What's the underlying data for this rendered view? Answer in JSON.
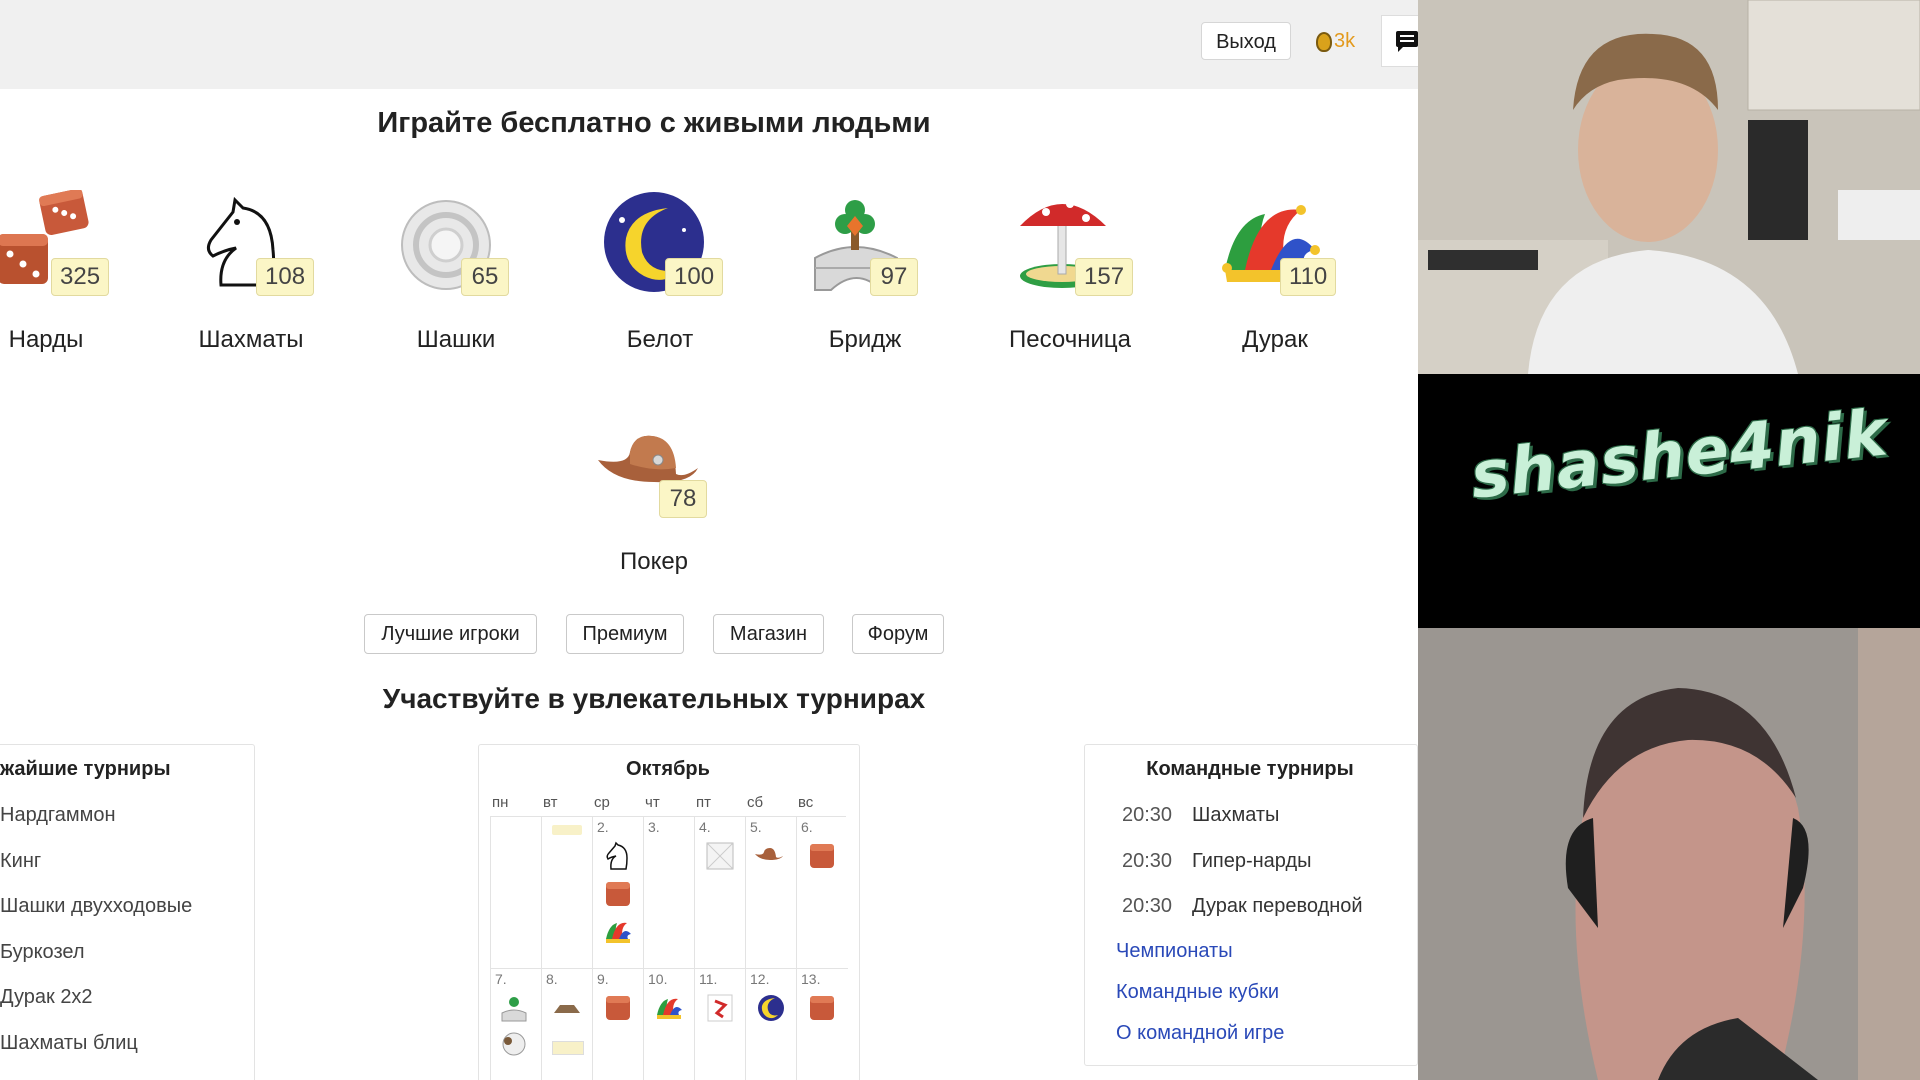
{
  "topbar": {
    "exit_label": "Выход",
    "coins": "3k"
  },
  "heading_play": "Играйте бесплатно с живыми людьми",
  "games": [
    {
      "name": "Нарды",
      "count": "325",
      "icon": "dice-icon"
    },
    {
      "name": "Шахматы",
      "count": "108",
      "icon": "chess-knight-icon"
    },
    {
      "name": "Шашки",
      "count": "65",
      "icon": "checker-piece-icon"
    },
    {
      "name": "Белот",
      "count": "100",
      "icon": "moon-icon"
    },
    {
      "name": "Бридж",
      "count": "97",
      "icon": "bridge-icon"
    },
    {
      "name": "Песочница",
      "count": "157",
      "icon": "mushroom-sandbox-icon"
    },
    {
      "name": "Дурак",
      "count": "110",
      "icon": "jester-hat-icon"
    },
    {
      "name": "Покер",
      "count": "78",
      "icon": "cowboy-hat-icon"
    }
  ],
  "links": [
    "Лучшие игроки",
    "Премиум",
    "Магазин",
    "Форум"
  ],
  "heading_tournaments": "Участвуйте в увлекательных турнирах",
  "nearest": {
    "title": "жайшие турниры",
    "items": [
      "Нардгаммон",
      "Кинг",
      "Шашки двухходовые",
      "Буркозел",
      "Дурак 2х2",
      "Шахматы блиц"
    ]
  },
  "calendar": {
    "month": "Октябрь",
    "weekdays": [
      "пн",
      "вт",
      "ср",
      "чт",
      "пт",
      "сб",
      "вс"
    ],
    "week1_days": [
      "",
      "",
      "2.",
      "3.",
      "4.",
      "5.",
      "6."
    ],
    "week2_days": [
      "7.",
      "8.",
      "9.",
      "10.",
      "11.",
      "12.",
      "13."
    ]
  },
  "team": {
    "title": "Командные турниры",
    "rows": [
      {
        "time": "20:30",
        "name": "Шахматы"
      },
      {
        "time": "20:30",
        "name": "Гипер-нарды"
      },
      {
        "time": "20:30",
        "name": "Дурак переводной"
      }
    ],
    "links": [
      "Чемпионаты",
      "Командные кубки",
      "О командной игре"
    ]
  },
  "stream": {
    "nickname": "shashe4nik"
  },
  "colors": {
    "badge_bg": "#fbf6c6",
    "link_blue": "#2a49b8",
    "topbar_bg": "#f0f0f0",
    "coin": "#e39a1d"
  }
}
